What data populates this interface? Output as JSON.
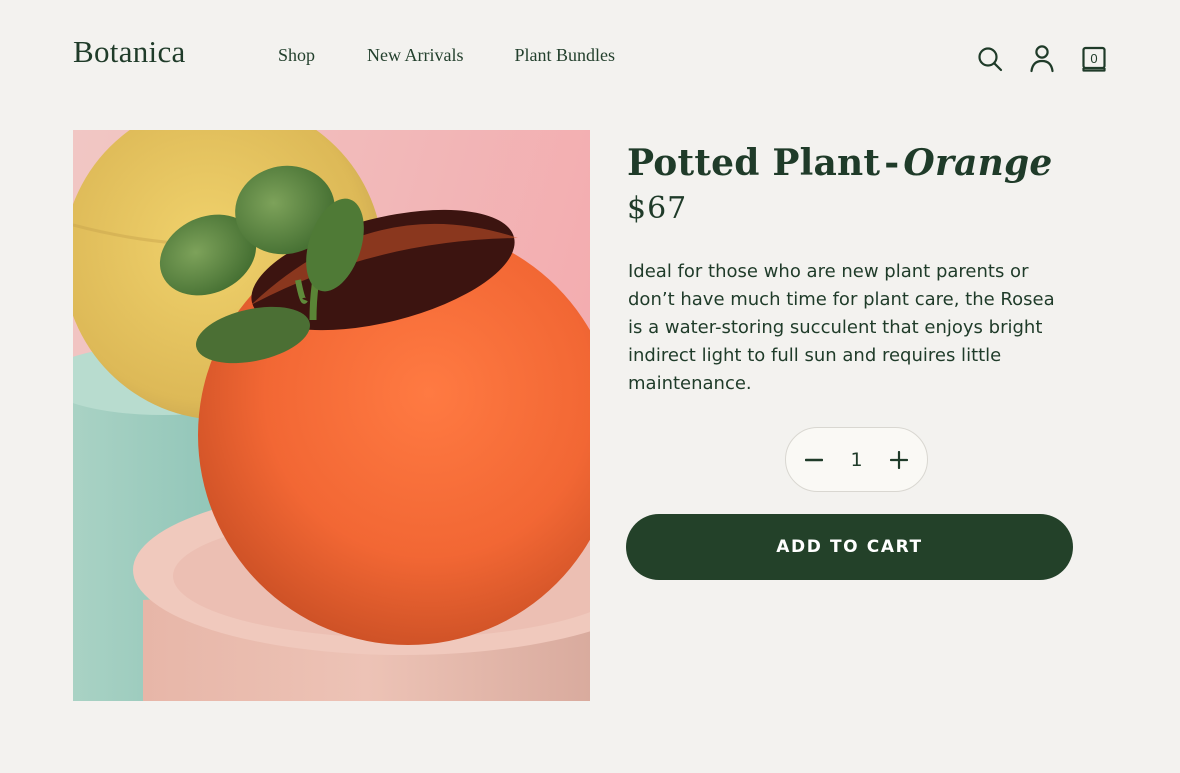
{
  "header": {
    "brand": "Botanica",
    "nav": [
      "Shop",
      "New Arrivals",
      "Plant Bundles"
    ],
    "icons": [
      "search-icon",
      "account-icon",
      "cart-icon"
    ],
    "cart_count": "0"
  },
  "product": {
    "title_main": "Potted Plant",
    "title_separator": "-",
    "title_variant": "Orange",
    "price": "$67",
    "description": "Ideal for those who are new plant parents or don’t have much time for plant care, the Rosea is a water-storing succulent that enjoys bright indirect light to full sun and requires little maintenance.",
    "quantity": "1",
    "add_to_cart_label": "ADD TO CART"
  },
  "colors": {
    "background": "#f3f2ef",
    "primary_green": "#234129",
    "text": "#1f3b29",
    "pot_orange": "#f06a3a"
  }
}
